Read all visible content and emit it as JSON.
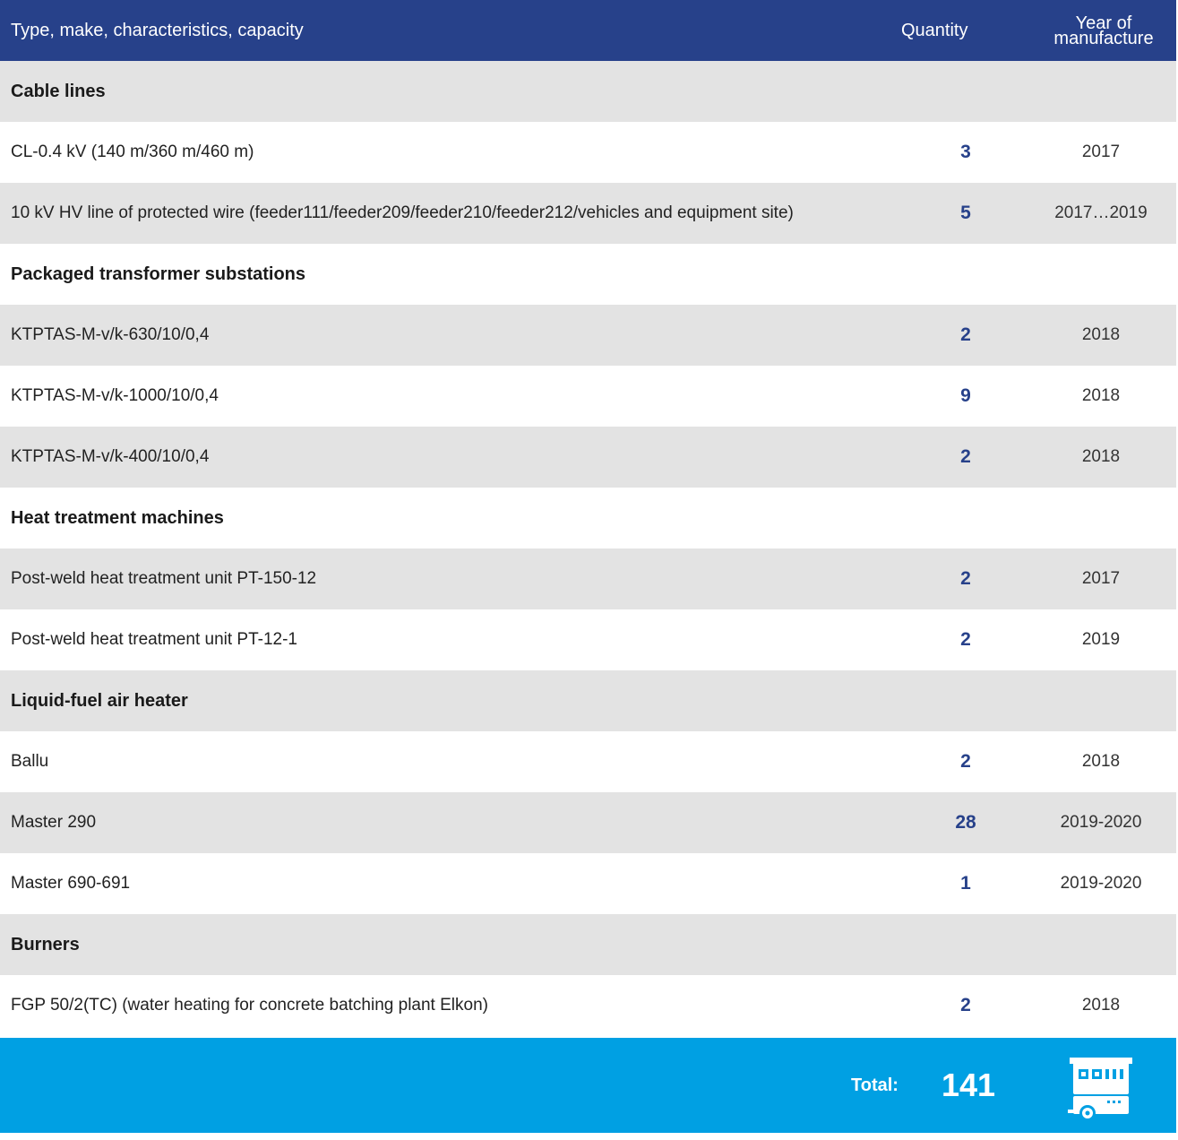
{
  "header": {
    "type_label": "Type, make, characteristics, capacity",
    "quantity_label": "Quantity",
    "year_label_line1": "Year of",
    "year_label_line2": "manufacture"
  },
  "rows": [
    {
      "kind": "section",
      "label": "Cable lines"
    },
    {
      "kind": "item",
      "label": "CL-0.4 kV (140 m/360 m/460 m)",
      "quantity": "3",
      "year": "2017"
    },
    {
      "kind": "item",
      "label": "10 kV HV line of protected wire (feeder111/feeder209/feeder210/feeder212/vehicles and equipment site)",
      "quantity": "5",
      "year": "2017…2019"
    },
    {
      "kind": "section",
      "label": "Packaged transformer substations"
    },
    {
      "kind": "item",
      "label": "KTPTAS-M-v/k-630/10/0,4",
      "quantity": "2",
      "year": "2018"
    },
    {
      "kind": "item",
      "label": "KTPTAS-M-v/k-1000/10/0,4",
      "quantity": "9",
      "year": "2018"
    },
    {
      "kind": "item",
      "label": "KTPTAS-M-v/k-400/10/0,4",
      "quantity": "2",
      "year": "2018"
    },
    {
      "kind": "section",
      "label": "Heat treatment machines"
    },
    {
      "kind": "item",
      "label": "Post-weld heat treatment unit PT-150-12",
      "quantity": "2",
      "year": "2017"
    },
    {
      "kind": "item",
      "label": "Post-weld heat treatment unit PT-12-1",
      "quantity": "2",
      "year": "2019"
    },
    {
      "kind": "section",
      "label": "Liquid-fuel air heater"
    },
    {
      "kind": "item",
      "label": "Ballu",
      "quantity": "2",
      "year": "2018"
    },
    {
      "kind": "item",
      "label": "Master 290",
      "quantity": "28",
      "year": "2019-2020"
    },
    {
      "kind": "item",
      "label": "Master 690-691",
      "quantity": "1",
      "year": "2019-2020"
    },
    {
      "kind": "section",
      "label": "Burners"
    },
    {
      "kind": "item",
      "label": "FGP 50/2(TC) (water heating for concrete batching plant Elkon)",
      "quantity": "2",
      "year": "2018"
    }
  ],
  "footer": {
    "total_label": "Total:",
    "total_value": "141",
    "icon": "generator-icon"
  },
  "colors": {
    "header_bg": "#27418a",
    "row_alt_bg": "#e3e3e3",
    "quantity_text": "#27418a",
    "footer_bg": "#00a0e3"
  }
}
